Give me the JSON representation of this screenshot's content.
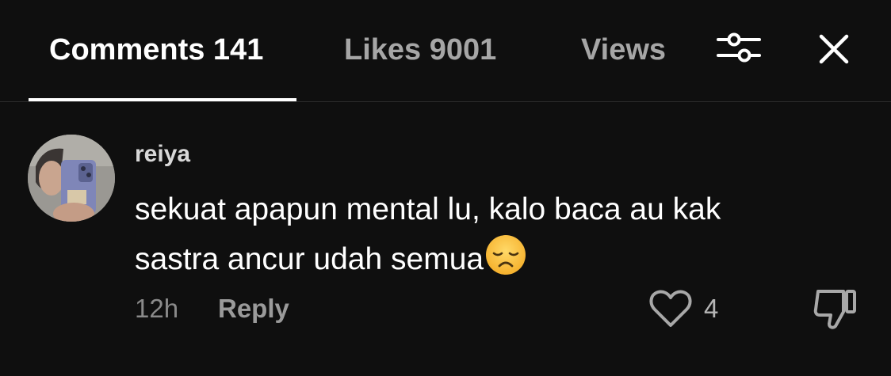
{
  "tabs": {
    "comments_label": "Comments 141",
    "likes_label": "Likes 9001",
    "views_label": "Views"
  },
  "header": {
    "filter_icon": "sliders-icon",
    "close_icon": "close-icon"
  },
  "comment": {
    "username": "reiya",
    "text": "sekuat apapun mental lu, kalo baca au kak sastra ancur udah semua",
    "emoji": "disappointed-face-emoji",
    "time": "12h",
    "reply_label": "Reply",
    "like_count": "4",
    "like_icon": "heart-outline-icon",
    "dislike_icon": "thumbs-down-icon"
  },
  "colors": {
    "background": "#0f0f0f",
    "active_tab": "#ffffff",
    "inactive_tab": "#a6a6a6",
    "meta_text": "#8a8a8a"
  }
}
